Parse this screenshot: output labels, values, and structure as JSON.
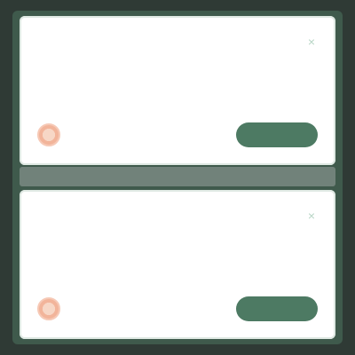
{
  "cards": [
    {
      "message": "",
      "meta": "",
      "action_label": ""
    },
    {
      "message": "",
      "meta": "",
      "action_label": ""
    }
  ],
  "colors": {
    "background": "#2f3a35",
    "frame": "#3f5a4c",
    "card": "#ffffff",
    "accent": "#4d7a63",
    "avatar": "#f2b49a"
  },
  "icons": {
    "close": "close-icon",
    "avatar": "avatar"
  }
}
